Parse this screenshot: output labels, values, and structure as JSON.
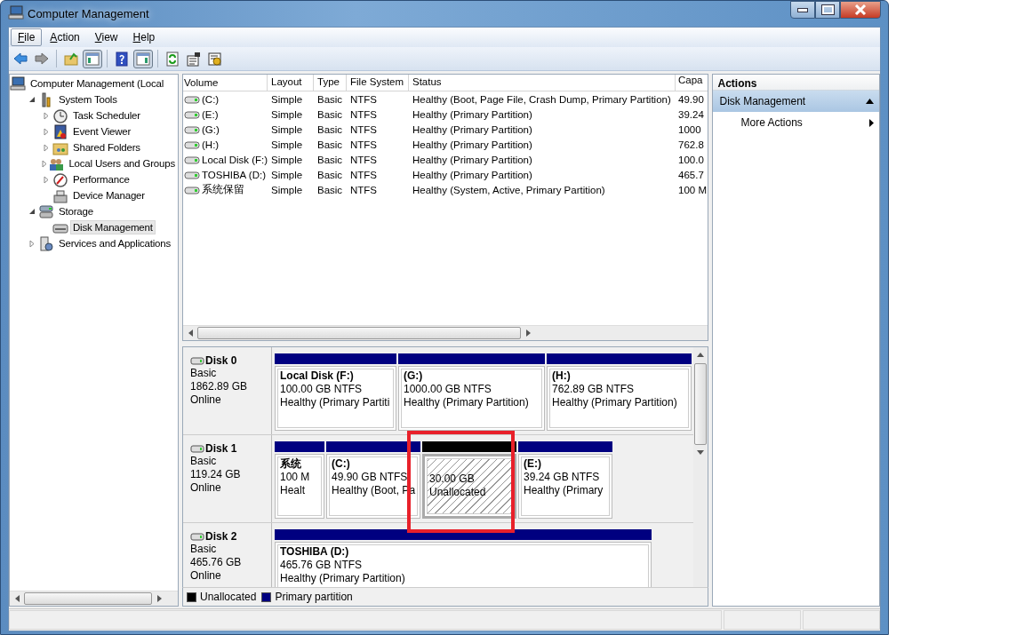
{
  "window": {
    "title": "Computer Management"
  },
  "menu": [
    {
      "label": "File",
      "selected": true
    },
    {
      "label": "Action",
      "selected": false
    },
    {
      "label": "View",
      "selected": false
    },
    {
      "label": "Help",
      "selected": false
    }
  ],
  "toolbar": [
    {
      "kind": "back",
      "pressed": false
    },
    {
      "kind": "forward",
      "pressed": false
    },
    {
      "kind": "separator"
    },
    {
      "kind": "up",
      "pressed": false
    },
    {
      "kind": "tree",
      "pressed": true
    },
    {
      "kind": "separator"
    },
    {
      "kind": "help",
      "pressed": false
    },
    {
      "kind": "pane",
      "pressed": true
    },
    {
      "kind": "separator"
    },
    {
      "kind": "refresh",
      "pressed": false
    },
    {
      "kind": "properties",
      "pressed": false
    },
    {
      "kind": "settings",
      "pressed": false
    }
  ],
  "tree": [
    {
      "label": "Computer Management (Local",
      "selected": false,
      "children": [
        {
          "label": "System Tools",
          "expanded": true,
          "selected": false,
          "children": [
            {
              "label": "Task Scheduler",
              "expanded": false,
              "selected": false
            },
            {
              "label": "Event Viewer",
              "expanded": false,
              "selected": false
            },
            {
              "label": "Shared Folders",
              "expanded": false,
              "selected": false
            },
            {
              "label": "Local Users and Groups",
              "expanded": false,
              "selected": false
            },
            {
              "label": "Performance",
              "expanded": false,
              "selected": false
            },
            {
              "label": "Device Manager",
              "selected": false
            }
          ]
        },
        {
          "label": "Storage",
          "expanded": true,
          "selected": false,
          "children": [
            {
              "label": "Disk Management",
              "selected": true
            }
          ]
        },
        {
          "label": "Services and Applications",
          "expanded": false,
          "selected": false
        }
      ]
    }
  ],
  "table": {
    "columns": [
      "Volume",
      "Layout",
      "Type",
      "File System",
      "Status",
      "Capa"
    ],
    "rows": [
      {
        "cells": [
          "(C:)",
          "Simple",
          "Basic",
          "NTFS",
          "Healthy (Boot, Page File, Crash Dump, Primary Partition)",
          "49.90"
        ]
      },
      {
        "cells": [
          "(E:)",
          "Simple",
          "Basic",
          "NTFS",
          "Healthy (Primary Partition)",
          "39.24"
        ]
      },
      {
        "cells": [
          "(G:)",
          "Simple",
          "Basic",
          "NTFS",
          "Healthy (Primary Partition)",
          "1000"
        ]
      },
      {
        "cells": [
          "(H:)",
          "Simple",
          "Basic",
          "NTFS",
          "Healthy (Primary Partition)",
          "762.8"
        ]
      },
      {
        "cells": [
          "Local Disk (F:)",
          "Simple",
          "Basic",
          "NTFS",
          "Healthy (Primary Partition)",
          "100.0"
        ]
      },
      {
        "cells": [
          "TOSHIBA (D:)",
          "Simple",
          "Basic",
          "NTFS",
          "Healthy (Primary Partition)",
          "465.7"
        ]
      },
      {
        "cells": [
          "系统保留",
          "Simple",
          "Basic",
          "NTFS",
          "Healthy (System, Active, Primary Partition)",
          "100 M"
        ]
      }
    ]
  },
  "disks": [
    {
      "name": "Disk 0",
      "type": "Basic",
      "size": "1862.89 GB",
      "status": "Online",
      "partitions": [
        {
          "kind": "primary",
          "selected": false,
          "title": "Local Disk  (F:)",
          "size": "100.00 GB NTFS",
          "status": "Healthy (Primary Partiti"
        },
        {
          "kind": "primary",
          "selected": false,
          "title": "(G:)",
          "size": "1000.00 GB NTFS",
          "status": "Healthy (Primary Partition)"
        },
        {
          "kind": "primary",
          "selected": false,
          "title": "(H:)",
          "size": "762.89 GB NTFS",
          "status": "Healthy (Primary Partition)"
        }
      ]
    },
    {
      "name": "Disk 1",
      "type": "Basic",
      "size": "119.24 GB",
      "status": "Online",
      "partitions": [
        {
          "kind": "primary",
          "selected": false,
          "title": "系统",
          "size": "100 M",
          "status": "Healt"
        },
        {
          "kind": "primary",
          "selected": false,
          "title": "(C:)",
          "size": "49.90 GB NTFS",
          "status": "Healthy (Boot, Pa"
        },
        {
          "kind": "unallocated",
          "selected": true,
          "size": "30.00 GB",
          "status": "Unallocated"
        },
        {
          "kind": "primary",
          "selected": false,
          "title": "(E:)",
          "size": "39.24 GB NTFS",
          "status": "Healthy (Primary"
        }
      ]
    },
    {
      "name": "Disk 2",
      "type": "Basic",
      "size": "465.76 GB",
      "status": "Online",
      "partitions": [
        {
          "kind": "primary",
          "selected": false,
          "title": "TOSHIBA  (D:)",
          "size": "465.76 GB NTFS",
          "status": "Healthy (Primary Partition)"
        }
      ]
    }
  ],
  "legend": [
    {
      "label": "Unallocated",
      "color": "#000000"
    },
    {
      "label": "Primary partition",
      "color": "#000080"
    }
  ],
  "actions": {
    "title": "Actions",
    "section": {
      "label": "Disk Management",
      "expanded": true
    },
    "items": [
      {
        "label": "More Actions",
        "submenu": true
      }
    ]
  }
}
